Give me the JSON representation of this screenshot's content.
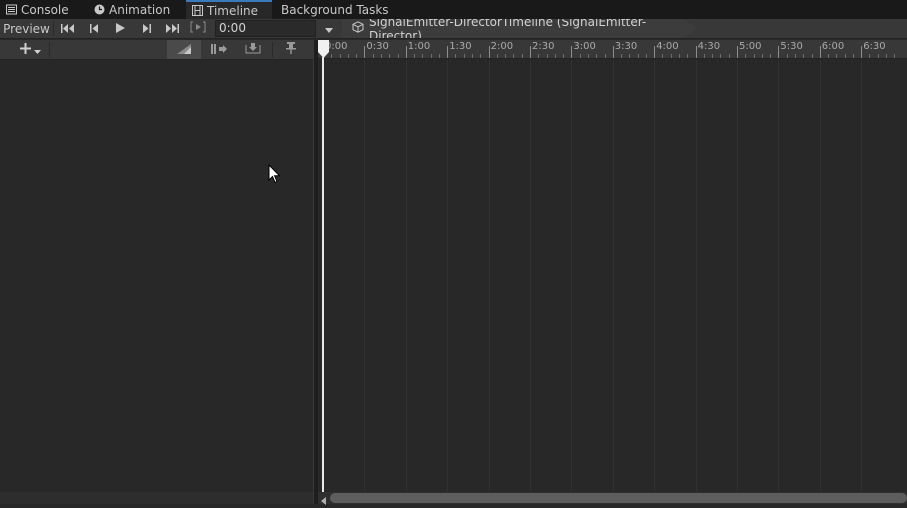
{
  "tabs": [
    {
      "label": "Console",
      "icon": "console-icon",
      "active": false
    },
    {
      "label": "Animation",
      "icon": "clock-icon",
      "active": false
    },
    {
      "label": "Timeline",
      "icon": "film-icon",
      "active": true
    },
    {
      "label": "Background Tasks",
      "icon": "",
      "active": false
    }
  ],
  "toolbar": {
    "preview_label": "Preview",
    "time_value": "0:00",
    "breadcrumb": "SignalEmitter-DirectorTimeline (SignalEmitter-Director)"
  },
  "icons": {
    "goto_start": "skip-to-start-icon",
    "prev_frame": "previous-frame-icon",
    "play": "play-icon",
    "next_frame": "next-frame-icon",
    "goto_end": "skip-to-end-icon",
    "range": "play-range-icon",
    "dropdown": "chevron-down-icon",
    "asset": "cube-icon",
    "add": "plus-icon",
    "snap": "snap-icon",
    "ripple": "ripple-icon",
    "import": "import-icon",
    "pin": "pin-icon"
  },
  "ruler": {
    "labels": [
      "0:00",
      "0:30",
      "1:00",
      "1:30",
      "2:00",
      "2:30",
      "3:00",
      "3:30",
      "4:00",
      "4:30",
      "5:00",
      "5:30",
      "6:00",
      "6:30"
    ]
  },
  "colors": {
    "accent": "#3a79bb",
    "background": "#282828",
    "toolbar": "#383838",
    "playhead": "#e8e8e8"
  }
}
